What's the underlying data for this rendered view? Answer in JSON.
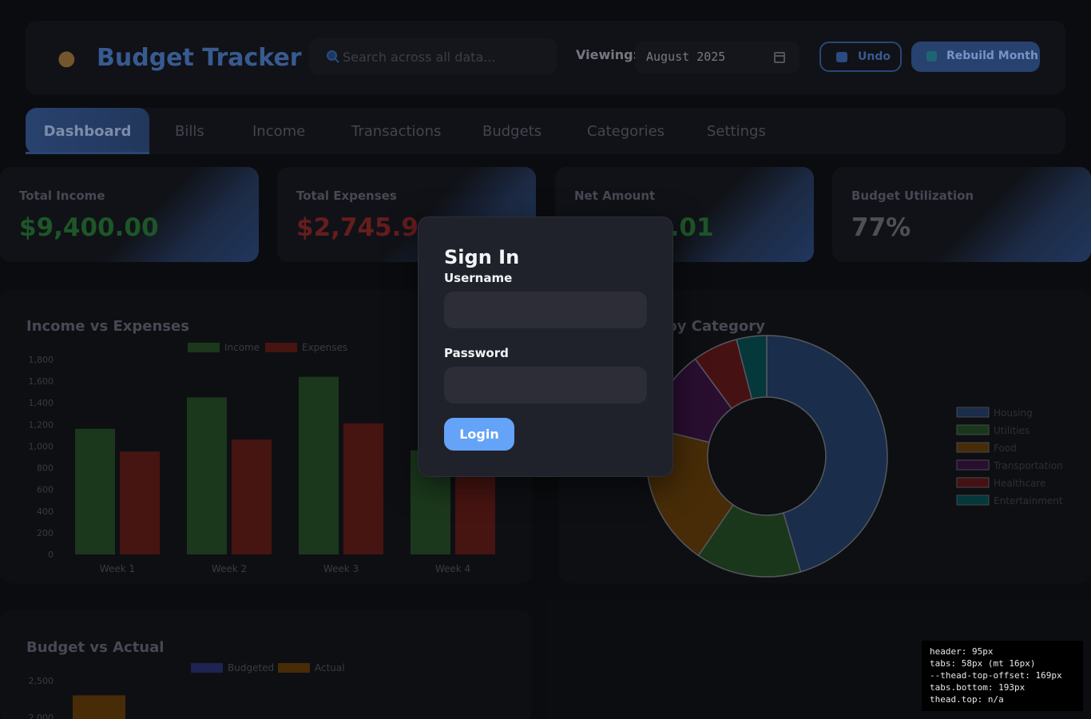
{
  "header": {
    "brand_icon": "money-bag-icon",
    "title": "Budget Tracker",
    "search_placeholder": "Search across all data...",
    "viewing_label": "Viewing:",
    "month_value": "August 2025",
    "undo_label": "Undo",
    "rebuild_label": "Rebuild Month"
  },
  "tabs": [
    "Dashboard",
    "Bills",
    "Income",
    "Transactions",
    "Budgets",
    "Categories",
    "Settings"
  ],
  "active_tab": "Dashboard",
  "stats": [
    {
      "label": "Total Income",
      "value": "$9,400.00",
      "color": "#1f5a2a"
    },
    {
      "label": "Total Expenses",
      "value": "$2,745.99",
      "color": "#6a1e1e"
    },
    {
      "label": "Net Amount",
      "value": "$6,654.01",
      "color": "#1f5a2a"
    },
    {
      "label": "Budget Utilization",
      "value": "77%",
      "color": "#52545c"
    }
  ],
  "panels": {
    "income_vs_expenses_title": "Income vs Expenses",
    "by_category_title": "Spending by Category",
    "budget_vs_actual_title": "Budget vs Actual"
  },
  "chart_data": [
    {
      "type": "bar",
      "title": "Income vs Expenses",
      "categories": [
        "Week 1",
        "Week 2",
        "Week 3",
        "Week 4"
      ],
      "series": [
        {
          "name": "Income",
          "values": [
            1160,
            1450,
            1640,
            960
          ],
          "color": "#1c3b1d"
        },
        {
          "name": "Expenses",
          "values": [
            950,
            1060,
            1210,
            870
          ],
          "color": "#4a1512"
        }
      ],
      "yticks": [
        0,
        200,
        400,
        600,
        800,
        "1,000",
        "1,200",
        "1,400",
        "1,600",
        "1,800"
      ],
      "ylim": [
        0,
        1800
      ],
      "legend": "top-center"
    },
    {
      "type": "pie",
      "title": "Spending by Category",
      "categories": [
        "Housing",
        "Utilities",
        "Food",
        "Transportation",
        "Healthcare",
        "Entertainment"
      ],
      "values": [
        45,
        14,
        19,
        11,
        6,
        4
      ],
      "colors": [
        "#1b2f4f",
        "#1b3a1d",
        "#4b2e07",
        "#2b0f32",
        "#4a1214",
        "#053b3e"
      ],
      "legend": "right"
    },
    {
      "type": "bar",
      "title": "Budget vs Actual",
      "series": [
        {
          "name": "Budgeted",
          "values": [],
          "color": "#1f2655"
        },
        {
          "name": "Actual",
          "values": [
            2300
          ],
          "color": "#4b2e07"
        }
      ],
      "yticks": [
        "2,500",
        "2,000"
      ],
      "legend": "top-center"
    }
  ],
  "modal": {
    "title": "Sign In",
    "username_label": "Username",
    "username_value": "",
    "password_label": "Password",
    "password_value": "",
    "login_label": "Login"
  },
  "debug": [
    "header: 95px",
    "tabs: 58px (mt 16px)",
    "--thead-top-offset: 169px",
    "tabs.bottom: 193px",
    "thead.top: n/a"
  ]
}
